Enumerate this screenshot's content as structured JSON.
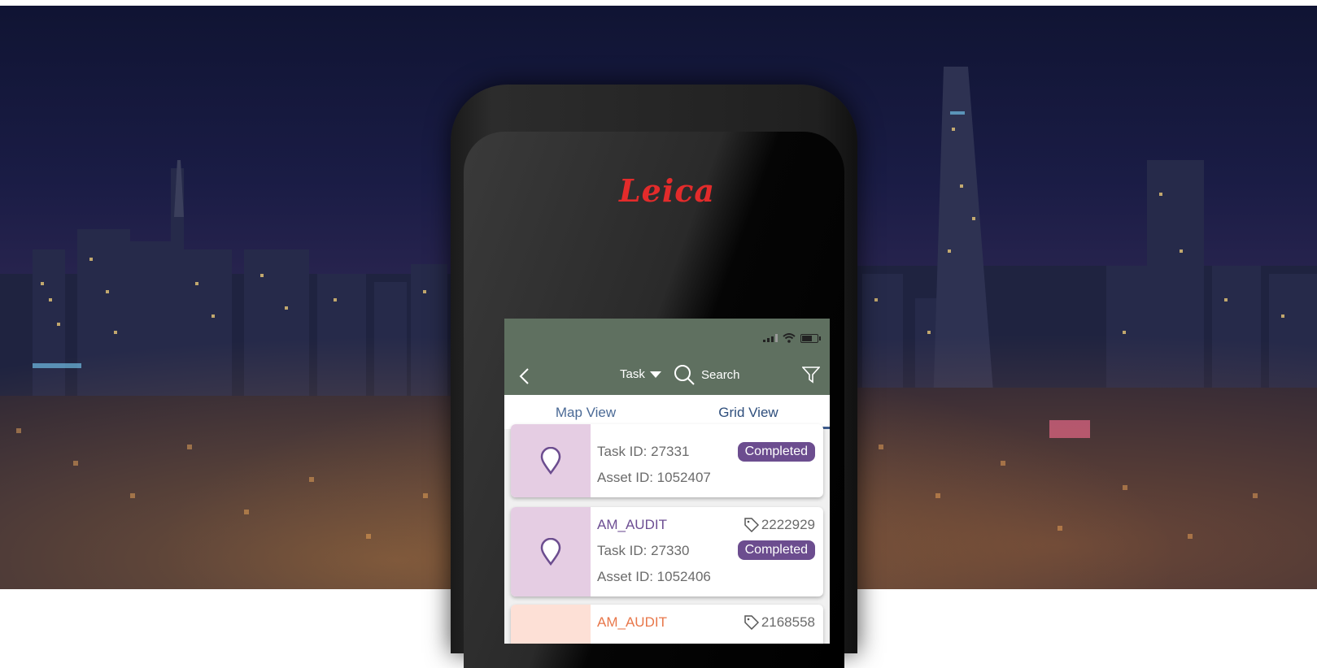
{
  "brand": {
    "logo_text": "Leica"
  },
  "app": {
    "toolbar": {
      "task_label": "Task",
      "search_placeholder": "Search"
    },
    "tabs": [
      {
        "label": "Map View",
        "active": false
      },
      {
        "label": "Grid View",
        "active": true
      }
    ],
    "cards": [
      {
        "title": "",
        "tag_number": "",
        "task_id": "Task ID: 27331",
        "status": "Completed",
        "asset_id": "Asset ID: 1052407"
      },
      {
        "title": "AM_AUDIT",
        "tag_number": "2222929",
        "task_id": "Task ID: 27330",
        "status": "Completed",
        "asset_id": "Asset ID: 1052406"
      },
      {
        "title": "AM_AUDIT",
        "tag_number": "2168558",
        "task_id": "",
        "status": "",
        "asset_id": ""
      }
    ]
  },
  "colors": {
    "appbar": "#5f7060",
    "accent_purple": "#6c4d8f",
    "accent_orange": "#e8774a",
    "tab_text": "#4b6a96",
    "logo_red": "#e32b2b"
  },
  "icons": [
    "back-chevron-icon",
    "dropdown-caret-icon",
    "search-icon",
    "filter-icon",
    "map-pin-icon",
    "tag-icon",
    "signal-icon",
    "wifi-icon",
    "battery-icon"
  ]
}
